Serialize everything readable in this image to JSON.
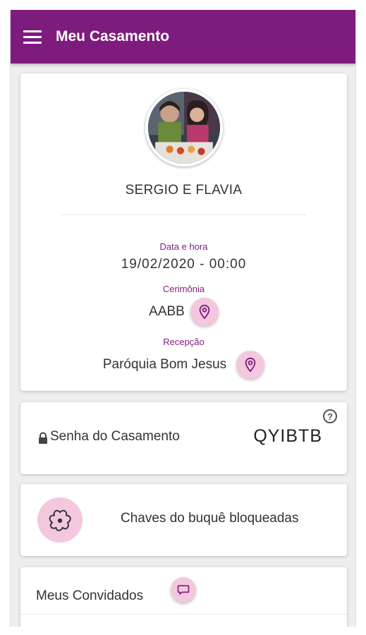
{
  "appbar": {
    "title": "Meu Casamento"
  },
  "couple": {
    "names": "SERGIO E FLAVIA",
    "date_label": "Data e hora",
    "date_value": "19/02/2020 - 00:00",
    "ceremony_label": "Cerimônia",
    "ceremony_value": "AABB",
    "reception_label": "Recepção",
    "reception_value": "Paróquia Bom Jesus"
  },
  "password": {
    "label": "Senha do Casamento",
    "value": "QYIBTB",
    "help_icon": "?"
  },
  "bouquet": {
    "label": "Chaves do buquê bloqueadas"
  },
  "guests": {
    "title": "Meus Convidados"
  },
  "colors": {
    "primary": "#7e1c7e",
    "accent_light": "#f3c8de"
  },
  "icons": [
    "menu-icon",
    "location-pin-icon",
    "help-icon",
    "lock-icon",
    "flower-icon",
    "chat-bubble-icon"
  ]
}
